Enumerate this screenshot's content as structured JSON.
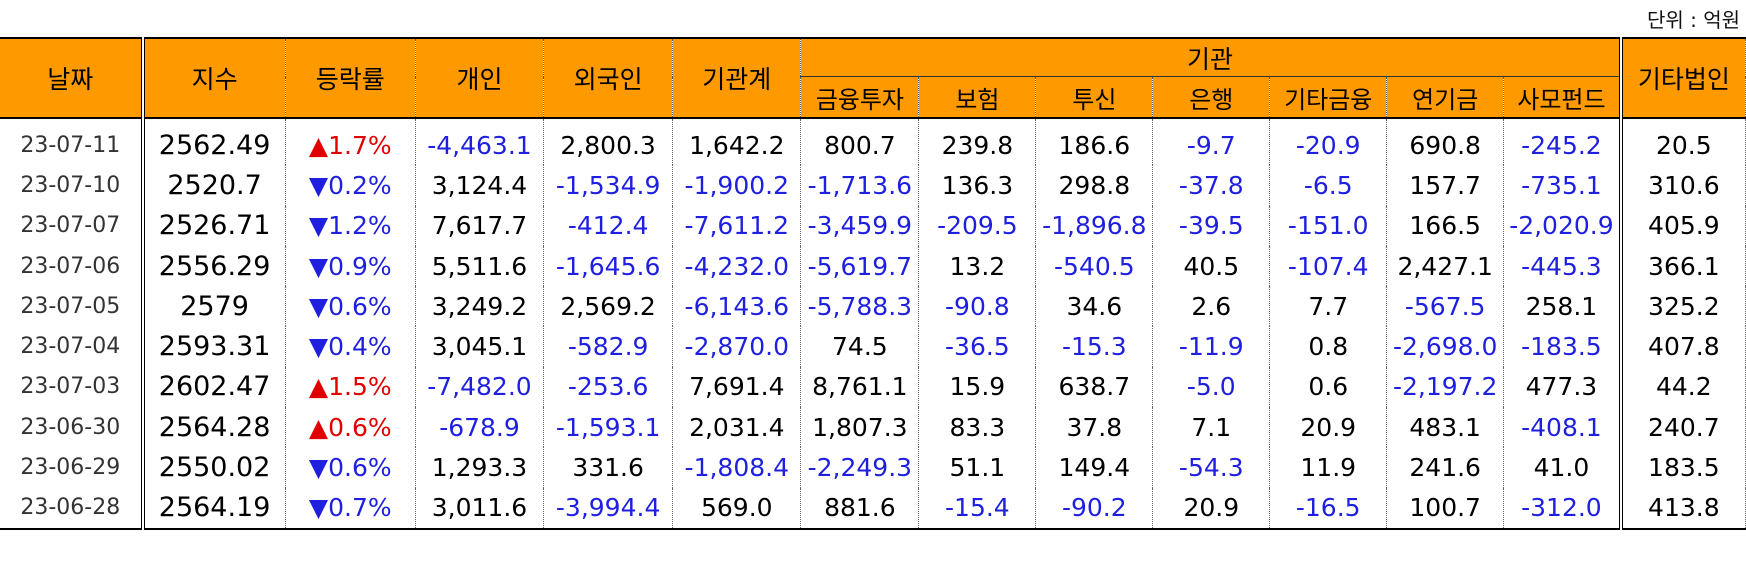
{
  "unit_label": "단위 : 억원",
  "headers": {
    "date": "날짜",
    "index": "지수",
    "change": "등락률",
    "individual": "개인",
    "foreign": "외국인",
    "institution_total": "기관계",
    "institution_group": "기관",
    "sub": [
      "금융투자",
      "보험",
      "투신",
      "은행",
      "기타금융",
      "연기금",
      "사모펀드"
    ],
    "other_corp": "기타법인"
  },
  "colors": {
    "header_bg": "#FF9900",
    "up": "#e00000",
    "down": "#1f1fe0",
    "negative": "#1f1fe0"
  },
  "rows": [
    {
      "date": "23-07-11",
      "index": "2562.49",
      "dir": "up",
      "change": "▲1.7%",
      "ind": "-4,463.1",
      "for": "2,800.3",
      "inst": "1,642.2",
      "c1": "800.7",
      "c2": "239.8",
      "c3": "186.6",
      "c4": "-9.7",
      "c5": "-20.9",
      "c6": "690.8",
      "c7": "-245.2",
      "oth": "20.5"
    },
    {
      "date": "23-07-10",
      "index": "2520.7",
      "dir": "down",
      "change": "▼0.2%",
      "ind": "3,124.4",
      "for": "-1,534.9",
      "inst": "-1,900.2",
      "c1": "-1,713.6",
      "c2": "136.3",
      "c3": "298.8",
      "c4": "-37.8",
      "c5": "-6.5",
      "c6": "157.7",
      "c7": "-735.1",
      "oth": "310.6"
    },
    {
      "date": "23-07-07",
      "index": "2526.71",
      "dir": "down",
      "change": "▼1.2%",
      "ind": "7,617.7",
      "for": "-412.4",
      "inst": "-7,611.2",
      "c1": "-3,459.9",
      "c2": "-209.5",
      "c3": "-1,896.8",
      "c4": "-39.5",
      "c5": "-151.0",
      "c6": "166.5",
      "c7": "-2,020.9",
      "oth": "405.9"
    },
    {
      "date": "23-07-06",
      "index": "2556.29",
      "dir": "down",
      "change": "▼0.9%",
      "ind": "5,511.6",
      "for": "-1,645.6",
      "inst": "-4,232.0",
      "c1": "-5,619.7",
      "c2": "13.2",
      "c3": "-540.5",
      "c4": "40.5",
      "c5": "-107.4",
      "c6": "2,427.1",
      "c7": "-445.3",
      "oth": "366.1"
    },
    {
      "date": "23-07-05",
      "index": "2579",
      "dir": "down",
      "change": "▼0.6%",
      "ind": "3,249.2",
      "for": "2,569.2",
      "inst": "-6,143.6",
      "c1": "-5,788.3",
      "c2": "-90.8",
      "c3": "34.6",
      "c4": "2.6",
      "c5": "7.7",
      "c6": "-567.5",
      "c7": "258.1",
      "oth": "325.2"
    },
    {
      "date": "23-07-04",
      "index": "2593.31",
      "dir": "down",
      "change": "▼0.4%",
      "ind": "3,045.1",
      "for": "-582.9",
      "inst": "-2,870.0",
      "c1": "74.5",
      "c2": "-36.5",
      "c3": "-15.3",
      "c4": "-11.9",
      "c5": "0.8",
      "c6": "-2,698.0",
      "c7": "-183.5",
      "oth": "407.8"
    },
    {
      "date": "23-07-03",
      "index": "2602.47",
      "dir": "up",
      "change": "▲1.5%",
      "ind": "-7,482.0",
      "for": "-253.6",
      "inst": "7,691.4",
      "c1": "8,761.1",
      "c2": "15.9",
      "c3": "638.7",
      "c4": "-5.0",
      "c5": "0.6",
      "c6": "-2,197.2",
      "c7": "477.3",
      "oth": "44.2"
    },
    {
      "date": "23-06-30",
      "index": "2564.28",
      "dir": "up",
      "change": "▲0.6%",
      "ind": "-678.9",
      "for": "-1,593.1",
      "inst": "2,031.4",
      "c1": "1,807.3",
      "c2": "83.3",
      "c3": "37.8",
      "c4": "7.1",
      "c5": "20.9",
      "c6": "483.1",
      "c7": "-408.1",
      "oth": "240.7"
    },
    {
      "date": "23-06-29",
      "index": "2550.02",
      "dir": "down",
      "change": "▼0.6%",
      "ind": "1,293.3",
      "for": "331.6",
      "inst": "-1,808.4",
      "c1": "-2,249.3",
      "c2": "51.1",
      "c3": "149.4",
      "c4": "-54.3",
      "c5": "11.9",
      "c6": "241.6",
      "c7": "41.0",
      "oth": "183.5"
    },
    {
      "date": "23-06-28",
      "index": "2564.19",
      "dir": "down",
      "change": "▼0.7%",
      "ind": "3,011.6",
      "for": "-3,994.4",
      "inst": "569.0",
      "c1": "881.6",
      "c2": "-15.4",
      "c3": "-90.2",
      "c4": "20.9",
      "c5": "-16.5",
      "c6": "100.7",
      "c7": "-312.0",
      "oth": "413.8"
    }
  ]
}
